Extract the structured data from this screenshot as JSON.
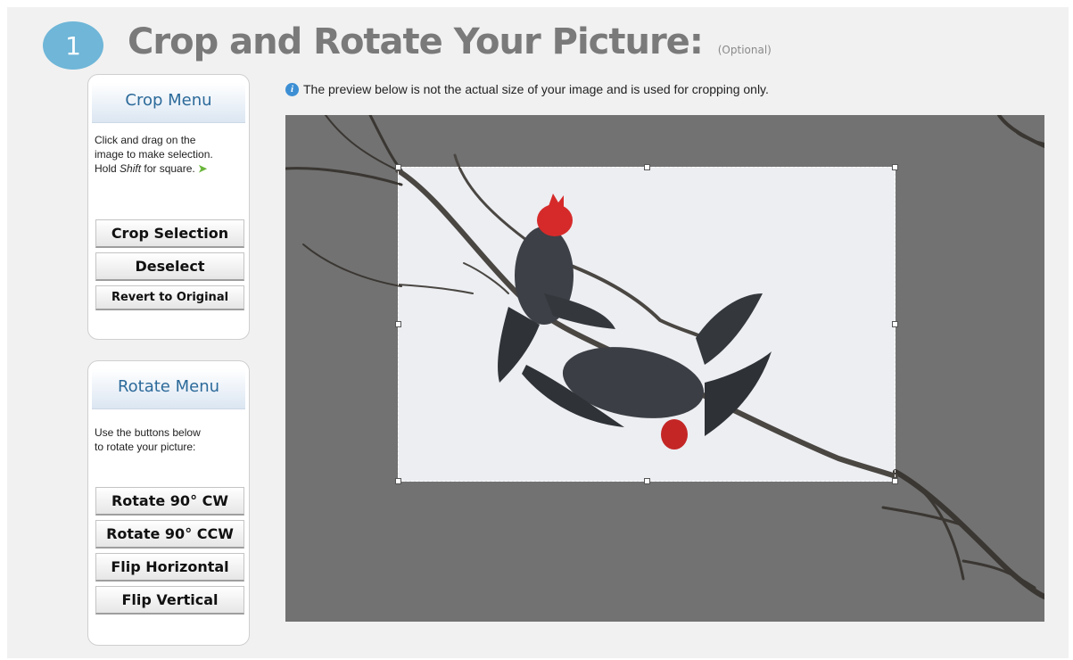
{
  "step": {
    "number": "1"
  },
  "header": {
    "title": "Crop and Rotate Your Picture:",
    "optional": "(Optional)"
  },
  "crop_menu": {
    "title": "Crop Menu",
    "desc_line1": "Click and drag on the",
    "desc_line2": "image to make selection.",
    "desc_hold": "Hold ",
    "desc_shift": "Shift",
    "desc_for": " for square.",
    "buttons": {
      "crop": "Crop Selection",
      "deselect": "Deselect",
      "revert": "Revert to Original"
    }
  },
  "rotate_menu": {
    "title": "Rotate Menu",
    "desc_line1": "Use the buttons below",
    "desc_line2": "to rotate your picture:",
    "buttons": {
      "cw": "Rotate 90° CW",
      "ccw": "Rotate 90° CCW",
      "flip_h": "Flip Horizontal",
      "flip_v": "Flip Vertical"
    }
  },
  "notice": {
    "text": "The preview below is not the actual size of your image and is used for cropping only."
  },
  "colors": {
    "accent": "#6fb6d8",
    "menu_title": "#2c6a9a",
    "preview_bg": "#727272"
  }
}
